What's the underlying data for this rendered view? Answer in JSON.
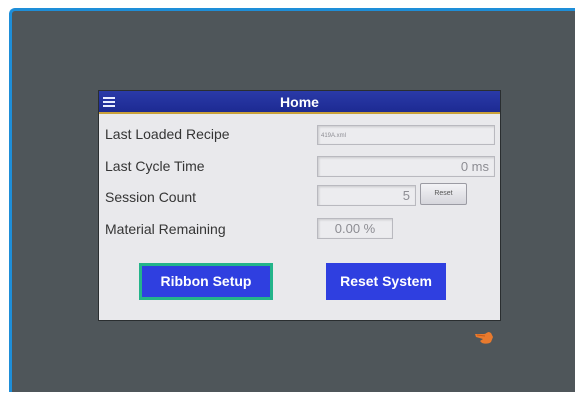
{
  "header": {
    "title": "Home"
  },
  "rows": {
    "last_loaded_recipe": {
      "label": "Last Loaded Recipe",
      "value": "419A.xml"
    },
    "last_cycle_time": {
      "label": "Last Cycle Time",
      "value": "0 ms"
    },
    "session_count": {
      "label": "Session Count",
      "value": "5",
      "reset_label": "Reset"
    },
    "material_remaining": {
      "label": "Material Remaining",
      "value": "0.00 %"
    }
  },
  "buttons": {
    "ribbon_setup": "Ribbon Setup",
    "reset_system": "Reset System"
  },
  "icons": {
    "menu": "menu-icon",
    "pointer": "pointing-hand-icon"
  },
  "colors": {
    "bezel": "#4f565a",
    "bezel_accent": "#1e8ed8",
    "titlebar": "#1d2a92",
    "titlebar_underline": "#c9a13a",
    "button_blue": "#2f3fe0",
    "selected_outline": "#24b48a",
    "hand": "#e87a2e"
  }
}
